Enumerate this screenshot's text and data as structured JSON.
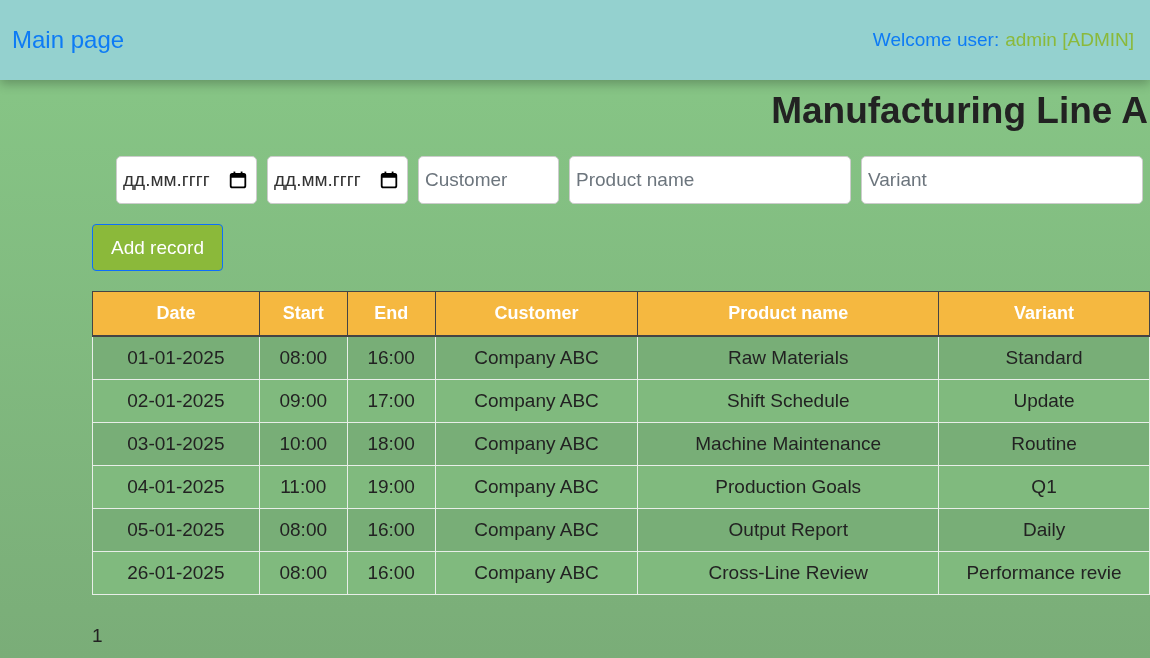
{
  "navbar": {
    "brand": "Main page",
    "welcome_label": "Welcome user:",
    "user": "admin [ADMIN]"
  },
  "title": "Manufacturing Line A",
  "filters": [
    {
      "kind": "date",
      "placeholder": "дд.мм.гггг"
    },
    {
      "kind": "date",
      "placeholder": "дд.мм.гггг"
    },
    {
      "kind": "text",
      "placeholder": "Customer"
    },
    {
      "kind": "text",
      "placeholder": "Product name"
    },
    {
      "kind": "text",
      "placeholder": "Variant"
    }
  ],
  "add_button": "Add record",
  "table": {
    "columns": [
      "Date",
      "Start",
      "End",
      "Customer",
      "Product name",
      "Variant"
    ],
    "rows": [
      [
        "01-01-2025",
        "08:00",
        "16:00",
        "Company ABC",
        "Raw Materials",
        "Standard"
      ],
      [
        "02-01-2025",
        "09:00",
        "17:00",
        "Company ABC",
        "Shift Schedule",
        "Update"
      ],
      [
        "03-01-2025",
        "10:00",
        "18:00",
        "Company ABC",
        "Machine Maintenance",
        "Routine"
      ],
      [
        "04-01-2025",
        "11:00",
        "19:00",
        "Company ABC",
        "Production Goals",
        "Q1"
      ],
      [
        "05-01-2025",
        "08:00",
        "16:00",
        "Company ABC",
        "Output Report",
        "Daily"
      ],
      [
        "26-01-2025",
        "08:00",
        "16:00",
        "Company ABC",
        "Cross-Line Review",
        "Performance revie"
      ]
    ]
  },
  "pagination": "1"
}
